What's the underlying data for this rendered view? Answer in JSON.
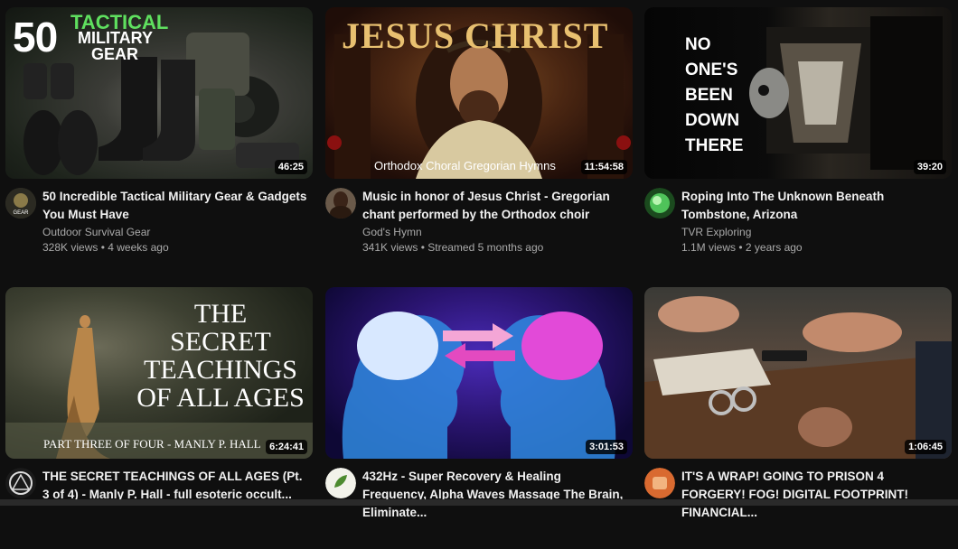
{
  "videos": [
    {
      "thumb_text_main": "50",
      "thumb_text_sub1": "TACTICAL",
      "thumb_text_sub2": "MILITARY",
      "thumb_text_sub3": "GEAR",
      "duration": "46:25",
      "title": "50 Incredible Tactical Military Gear & Gadgets You Must Have",
      "channel": "Outdoor Survival Gear",
      "stats": "328K views • 4 weeks ago"
    },
    {
      "thumb_text_main": "JESUS CHRIST",
      "thumb_text_caption": "Orthodox Choral Gregorian Hymns",
      "duration": "11:54:58",
      "title": "Music in honor of Jesus Christ - Gregorian chant performed by the Orthodox choir",
      "channel": "God's Hymn",
      "stats": "341K views • Streamed 5 months ago"
    },
    {
      "thumb_text_lines": [
        "NO",
        "ONE'S",
        "BEEN",
        "DOWN",
        "THERE"
      ],
      "duration": "39:20",
      "title": "Roping Into The Unknown Beneath Tombstone, Arizona",
      "channel": "TVR Exploring",
      "stats": "1.1M views • 2 years ago"
    },
    {
      "thumb_text_lines": [
        "THE",
        "SECRET",
        "TEACHINGS",
        "OF ALL AGES"
      ],
      "thumb_text_caption": "PART THREE OF FOUR - MANLY P. HALL",
      "duration": "6:24:41",
      "title": "THE SECRET TEACHINGS OF ALL AGES (Pt. 3 of 4) - Manly P. Hall - full esoteric occult...",
      "channel": "",
      "stats": ""
    },
    {
      "duration": "3:01:53",
      "title": "432Hz - Super Recovery & Healing Frequency, Alpha Waves Massage The Brain, Eliminate...",
      "channel": "",
      "stats": ""
    },
    {
      "duration": "1:06:45",
      "title": "IT'S A WRAP! GOING TO PRISON 4 FORGERY! FOG! DIGITAL FOOTPRINT! FINANCIAL...",
      "channel": "",
      "stats": ""
    }
  ],
  "avatar_labels": {
    "first": "GEAR"
  },
  "colors": {
    "background": "#0f0f0f",
    "title": "#f1f1f1",
    "secondary": "#aaaaaa",
    "tactical_green": "#5fe05f",
    "gold": "#e8c070"
  }
}
